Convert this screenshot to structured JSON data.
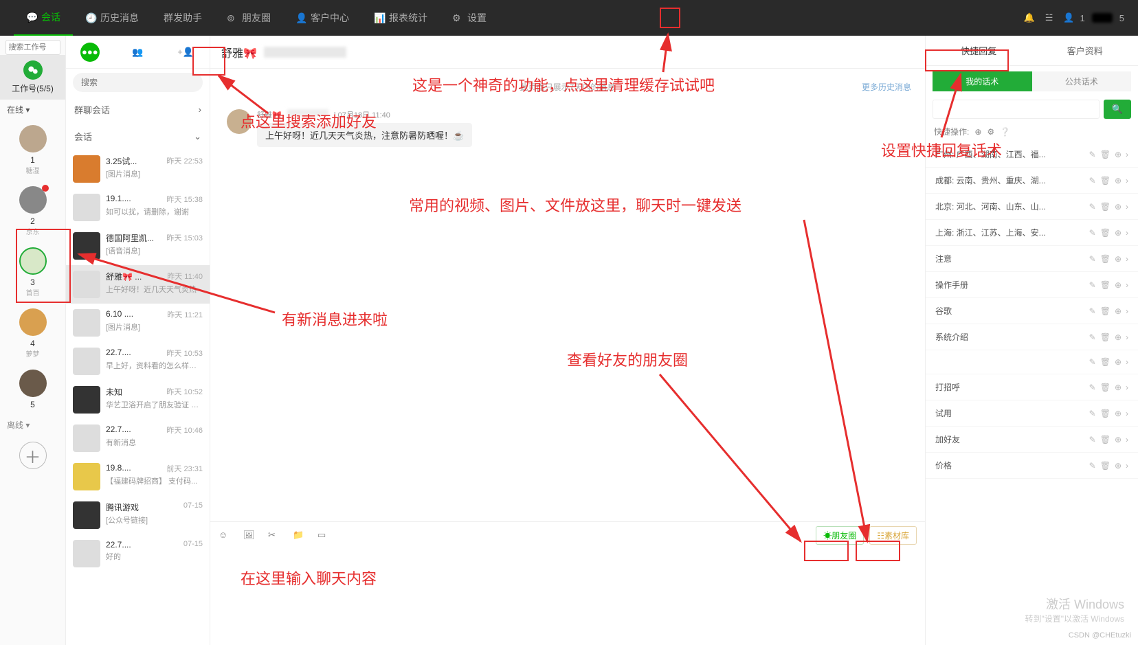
{
  "topbar": {
    "items": [
      {
        "label": "会话",
        "icon": "chat"
      },
      {
        "label": "历史消息",
        "icon": "clock"
      },
      {
        "label": "群发助手",
        "icon": "broadcast"
      },
      {
        "label": "朋友圈",
        "icon": "moments"
      },
      {
        "label": "客户中心",
        "icon": "user"
      },
      {
        "label": "报表统计",
        "icon": "stats"
      },
      {
        "label": "设置",
        "icon": "gear"
      }
    ],
    "user_count1": "1",
    "user_count2": "5"
  },
  "accounts": {
    "search_placeholder": "搜索工作号",
    "header": "工作号(5/5)",
    "online_label": "在线",
    "offline_label": "离线",
    "list": [
      {
        "num": "1",
        "label": "糖湿"
      },
      {
        "num": "2",
        "label": "京东",
        "new": true
      },
      {
        "num": "3",
        "label": "首百"
      },
      {
        "num": "4",
        "label": "萝梦"
      },
      {
        "num": "5",
        "label": ""
      }
    ]
  },
  "convlist": {
    "search_placeholder": "搜索",
    "group_header": "群聊会话",
    "conv_header": "会话",
    "items": [
      {
        "name": "3.25试...",
        "time": "昨天 22:53",
        "preview": "[图片消息]",
        "avcls": "orange"
      },
      {
        "name": "19.1....",
        "time": "昨天 15:38",
        "preview": "如可以扰，请删除，谢谢",
        "avcls": ""
      },
      {
        "name": "德国阿里凯...",
        "time": "昨天 15:03",
        "preview": "[语音消息]",
        "avcls": "dark"
      },
      {
        "name": "舒雅🎀 ...",
        "time": "昨天 11:40",
        "preview": "上午好呀！近几天天气炎热",
        "avcls": "",
        "sel": true
      },
      {
        "name": "6.10 ....",
        "time": "昨天 11:21",
        "preview": "[图片消息]",
        "avcls": ""
      },
      {
        "name": "22.7....",
        "time": "昨天 10:53",
        "preview": "早上好，资料看的怎么样了...",
        "avcls": ""
      },
      {
        "name": "未知",
        "time": "昨天 10:52",
        "preview": "华艺卫浴开启了朋友验证 你...",
        "avcls": "dark"
      },
      {
        "name": "22.7....",
        "time": "昨天 10:46",
        "preview": "有新消息",
        "avcls": ""
      },
      {
        "name": "19.8....",
        "time": "前天 23:31",
        "preview": "【福建码牌招商】 支付码...",
        "avcls": "yellow"
      },
      {
        "name": "腾讯游戏",
        "time": "07-15",
        "preview": "[公众号链接]",
        "avcls": "dark"
      },
      {
        "name": "22.7....",
        "time": "07-15",
        "preview": "好的",
        "avcls": ""
      }
    ]
  },
  "chat": {
    "title": "舒雅",
    "info_line": "此页面只展示7天内的消息",
    "more_history": "更多历史消息",
    "msg": {
      "sender": "舒雅🎀",
      "time": "07月18日 11:40",
      "text": "上午好呀！近几天天气炎热，注意防暑防晒喔！☕"
    },
    "toolbar": {
      "moments": "朋友圈",
      "assets": "素材库"
    }
  },
  "rightpanel": {
    "tab1": "快捷回复",
    "tab2": "客户资料",
    "subtab1": "我的话术",
    "subtab2": "公共话术",
    "quick_ops_label": "快捷操作:",
    "items": [
      "广州: 广西、湖南、江西、福...",
      "成都: 云南、贵州、重庆、湖...",
      "北京: 河北、河南、山东、山...",
      "上海: 浙江、江苏、上海、安...",
      "注意",
      "操作手册",
      "谷歌",
      "系统介绍",
      "",
      "打招呼",
      "试用",
      "加好友",
      "价格"
    ]
  },
  "annotations": {
    "a1": "点这里搜索添加好友",
    "a2": "这是一个神奇的功能，点这里清理缓存试试吧",
    "a3": "设置快捷回复话术",
    "a4": "常用的视频、图片、文件放这里，聊天时一键发送",
    "a5": "有新消息进来啦",
    "a6": "查看好友的朋友圈",
    "a7": "在这里输入聊天内容"
  },
  "footer": {
    "activate": "激活 Windows",
    "activate2": "转到\"设置\"以激活 Windows",
    "watermark": "CSDN @CHEtuzki"
  }
}
